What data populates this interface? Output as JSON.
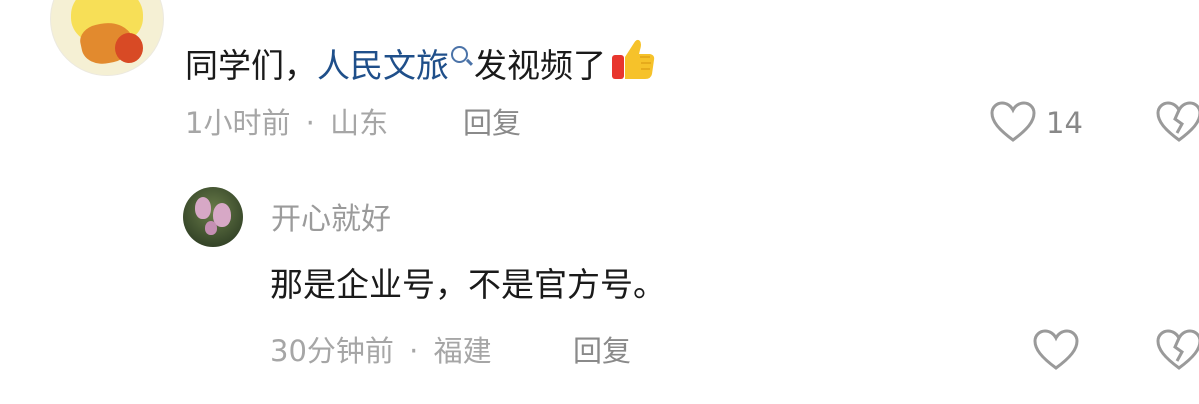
{
  "comment1": {
    "text_prefix": "同学们，",
    "mention": "人民文旅",
    "text_suffix": "发视频了",
    "emoji": "thumbs-up-icon",
    "time": "1小时前",
    "separator": "·",
    "location": "山东",
    "reply_label": "回复",
    "like_count": "14"
  },
  "comment2": {
    "username": "开心就好",
    "text": "那是企业号，不是官方号。",
    "time": "30分钟前",
    "separator": "·",
    "location": "福建",
    "reply_label": "回复",
    "like_count": ""
  },
  "colors": {
    "mention": "#1f4f8a",
    "meta": "#a6a6a6",
    "icon": "#9a9a9a"
  }
}
